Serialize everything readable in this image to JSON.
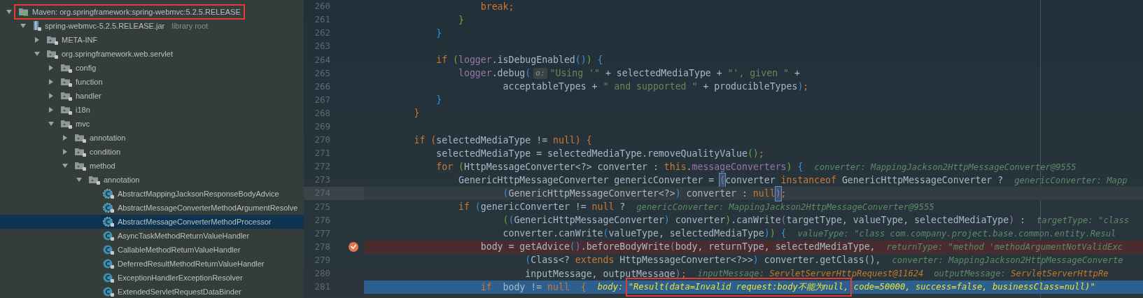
{
  "project_tree": {
    "items": [
      {
        "kind": "library",
        "label": "Maven: org.springframework:spring-webmvc:5.2.5.RELEASE",
        "expanded": true,
        "selected": false,
        "outlined": true,
        "children": [
          {
            "kind": "jar",
            "label": "spring-webmvc-5.2.5.RELEASE.jar",
            "note": "library root",
            "expanded": true,
            "selected": false,
            "outlined": false,
            "children": [
              {
                "kind": "package",
                "label": "META-INF",
                "expanded": false,
                "selected": false,
                "outlined": false
              },
              {
                "kind": "package",
                "label": "org.springframework.web.servlet",
                "expanded": true,
                "selected": false,
                "outlined": false,
                "children": [
                  {
                    "kind": "package",
                    "label": "config",
                    "expanded": false,
                    "selected": false,
                    "outlined": false
                  },
                  {
                    "kind": "package",
                    "label": "function",
                    "expanded": false,
                    "selected": false,
                    "outlined": false
                  },
                  {
                    "kind": "package",
                    "label": "handler",
                    "expanded": false,
                    "selected": false,
                    "outlined": false
                  },
                  {
                    "kind": "package",
                    "label": "i18n",
                    "expanded": false,
                    "selected": false,
                    "outlined": false
                  },
                  {
                    "kind": "package",
                    "label": "mvc",
                    "expanded": true,
                    "selected": false,
                    "outlined": false,
                    "children": [
                      {
                        "kind": "package",
                        "label": "annotation",
                        "expanded": false,
                        "selected": false,
                        "outlined": false
                      },
                      {
                        "kind": "package",
                        "label": "condition",
                        "expanded": false,
                        "selected": false,
                        "outlined": false
                      },
                      {
                        "kind": "package",
                        "label": "method",
                        "expanded": true,
                        "selected": false,
                        "outlined": false,
                        "children": [
                          {
                            "kind": "package",
                            "label": "annotation",
                            "expanded": true,
                            "selected": false,
                            "outlined": false,
                            "children": [
                              {
                                "kind": "abstract_class",
                                "label": "AbstractMappingJacksonResponseBodyAdvice",
                                "selected": false,
                                "outlined": false
                              },
                              {
                                "kind": "abstract_class",
                                "label": "AbstractMessageConverterMethodArgumentResolve",
                                "selected": false,
                                "outlined": false
                              },
                              {
                                "kind": "abstract_class",
                                "label": "AbstractMessageConverterMethodProcessor",
                                "selected": true,
                                "outlined": false
                              },
                              {
                                "kind": "class",
                                "label": "AsyncTaskMethodReturnValueHandler",
                                "selected": false,
                                "outlined": false
                              },
                              {
                                "kind": "class",
                                "label": "CallableMethodReturnValueHandler",
                                "selected": false,
                                "outlined": false
                              },
                              {
                                "kind": "class",
                                "label": "DeferredResultMethodReturnValueHandler",
                                "selected": false,
                                "outlined": false
                              },
                              {
                                "kind": "class",
                                "label": "ExceptionHandlerExceptionResolver",
                                "selected": false,
                                "outlined": false
                              },
                              {
                                "kind": "class",
                                "label": "ExtendedServletRequestDataBinder",
                                "selected": false,
                                "outlined": false
                              }
                            ]
                          }
                        ]
                      }
                    ]
                  }
                ]
              }
            ]
          }
        ]
      }
    ]
  },
  "editor": {
    "lines": [
      {
        "number": "260",
        "tokens": [
          {
            "kind": "keyword",
            "text": "                    break;"
          }
        ]
      },
      {
        "number": "261",
        "tokens": [
          {
            "kind": "brace_green",
            "text": "                }"
          }
        ]
      },
      {
        "number": "262",
        "tokens": [
          {
            "kind": "brace_blue",
            "text": "            }"
          }
        ]
      },
      {
        "number": "263"
      },
      {
        "number": "264",
        "tokens": [
          {
            "kind": "keyword",
            "text": "            if "
          },
          {
            "kind": "brace_green",
            "text": "("
          },
          {
            "kind": "field",
            "text": "logger"
          },
          {
            "kind": "plain",
            "text": ".isDebugEnabled"
          },
          {
            "kind": "brace_blue",
            "text": "()"
          },
          {
            "kind": "brace_green",
            "text": ")"
          },
          {
            "kind": "brace_blue",
            "text": " {"
          }
        ]
      },
      {
        "number": "265",
        "tokens": [
          {
            "kind": "field",
            "text": "                logger"
          },
          {
            "kind": "plain",
            "text": ".debug"
          },
          {
            "kind": "brace_blue",
            "text": "("
          },
          {
            "kind": "param_hint",
            "text": "o:"
          },
          {
            "kind": "string",
            "text": "\"Using '\""
          },
          {
            "kind": "plain",
            "text": " + selectedMediaType + "
          },
          {
            "kind": "string",
            "text": "\"', given \""
          },
          {
            "kind": "plain",
            "text": " +"
          }
        ]
      },
      {
        "number": "266",
        "tokens": [
          {
            "kind": "plain",
            "text": "                        acceptableTypes + "
          },
          {
            "kind": "string",
            "text": "\" and supported \""
          },
          {
            "kind": "plain",
            "text": " + producibleTypes"
          },
          {
            "kind": "brace_blue",
            "text": ")"
          },
          {
            "kind": "keyword",
            "text": ";"
          }
        ]
      },
      {
        "number": "267",
        "tokens": [
          {
            "kind": "brace_blue",
            "text": "            }"
          }
        ]
      },
      {
        "number": "268",
        "tokens": [
          {
            "kind": "keyword",
            "text": "        }"
          }
        ]
      },
      {
        "number": "269"
      },
      {
        "number": "270",
        "tokens": [
          {
            "kind": "keyword",
            "text": "        if ("
          },
          {
            "kind": "plain",
            "text": "selectedMediaType != "
          },
          {
            "kind": "keyword",
            "text": "null) {"
          }
        ]
      },
      {
        "number": "271",
        "tokens": [
          {
            "kind": "plain",
            "text": "            selectedMediaType = selectedMediaType.removeQualityValue"
          },
          {
            "kind": "brace_green",
            "text": "()"
          },
          {
            "kind": "keyword",
            "text": ";"
          }
        ]
      },
      {
        "number": "272",
        "tokens": [
          {
            "kind": "keyword",
            "text": "            for "
          },
          {
            "kind": "brace_green",
            "text": "("
          },
          {
            "kind": "plain",
            "text": "HttpMessageConverter<?> converter : "
          },
          {
            "kind": "keyword",
            "text": "this"
          },
          {
            "kind": "plain",
            "text": "."
          },
          {
            "kind": "field",
            "text": "messageConverters"
          },
          {
            "kind": "brace_green",
            "text": ")"
          },
          {
            "kind": "brace_blue",
            "text": " {"
          },
          {
            "kind": "hint",
            "text": "converter: MappingJackson2HttpMessageConverter@9555"
          }
        ]
      },
      {
        "number": "273",
        "tokens": [
          {
            "kind": "plain",
            "text": "                GenericHttpMessageConverter genericConverter = "
          },
          {
            "kind": "matched_brace",
            "text": "("
          },
          {
            "kind": "plain",
            "text": "converter "
          },
          {
            "kind": "keyword",
            "text": "instanceof"
          },
          {
            "kind": "plain",
            "text": " GenericHttpMessageConverter ?"
          },
          {
            "kind": "hint",
            "text": "genericConverter: Mapp"
          }
        ]
      },
      {
        "number": "274",
        "kind": "caret",
        "tokens": [
          {
            "kind": "brace_blue",
            "text": "                        ("
          },
          {
            "kind": "plain",
            "text": "GenericHttpMessageConverter<?>"
          },
          {
            "kind": "brace_blue",
            "text": ")"
          },
          {
            "kind": "plain",
            "text": " converter : "
          },
          {
            "kind": "keyword",
            "text": "null"
          },
          {
            "kind": "matched_brace",
            "text": ")"
          },
          {
            "kind": "keyword",
            "text": ";"
          }
        ]
      },
      {
        "number": "275",
        "tokens": [
          {
            "kind": "keyword",
            "text": "                if "
          },
          {
            "kind": "brace_blue",
            "text": "("
          },
          {
            "kind": "plain",
            "text": "genericConverter != "
          },
          {
            "kind": "keyword",
            "text": "null"
          },
          {
            "kind": "plain",
            "text": " ?"
          },
          {
            "kind": "hint",
            "text": "genericConverter: MappingJackson2HttpMessageConverter@9555"
          }
        ]
      },
      {
        "number": "276",
        "tokens": [
          {
            "kind": "brace_green",
            "text": "                        ("
          },
          {
            "kind": "brace_blue",
            "text": "("
          },
          {
            "kind": "plain",
            "text": "GenericHttpMessageConverter"
          },
          {
            "kind": "brace_blue",
            "text": ")"
          },
          {
            "kind": "plain",
            "text": " converter"
          },
          {
            "kind": "brace_green",
            "text": ")"
          },
          {
            "kind": "plain",
            "text": ".canWrite"
          },
          {
            "kind": "field",
            "text": "("
          },
          {
            "kind": "plain",
            "text": "targetType, valueType, selectedMediaType"
          },
          {
            "kind": "field",
            "text": ")"
          },
          {
            "kind": "plain",
            "text": " :"
          },
          {
            "kind": "hint",
            "text": "targetType: \"class"
          }
        ]
      },
      {
        "number": "277",
        "tokens": [
          {
            "kind": "plain",
            "text": "                        converter.canWrite"
          },
          {
            "kind": "brace_blue",
            "text": "("
          },
          {
            "kind": "plain",
            "text": "valueType, selectedMediaType"
          },
          {
            "kind": "brace_blue",
            "text": ")"
          },
          {
            "kind": "brace_green",
            "text": ")"
          },
          {
            "kind": "brace_blue",
            "text": " {"
          },
          {
            "kind": "hint",
            "text": "valueType: \"class com.company.project.base.common.entity.Resul"
          }
        ]
      },
      {
        "number": "278",
        "kind": "breakpoint",
        "tokens": [
          {
            "kind": "plain",
            "text": "                    body = getAdvice"
          },
          {
            "kind": "brace_blue",
            "text": "()"
          },
          {
            "kind": "plain",
            "text": ".beforeBodyWrite"
          },
          {
            "kind": "field",
            "text": "("
          },
          {
            "kind": "plain",
            "text": "body, returnType, selectedMediaType,"
          },
          {
            "kind": "hint",
            "text": "returnType: \"method 'methodArgumentNotValidExc"
          }
        ]
      },
      {
        "number": "279",
        "tokens": [
          {
            "kind": "brace_blue",
            "text": "                            ("
          },
          {
            "kind": "plain",
            "text": "Class<? "
          },
          {
            "kind": "keyword",
            "text": "extends"
          },
          {
            "kind": "plain",
            "text": " HttpMessageConverter<?>>"
          },
          {
            "kind": "brace_blue",
            "text": ")"
          },
          {
            "kind": "plain",
            "text": " converter.getClass(),"
          },
          {
            "kind": "hint",
            "text": "converter: MappingJackson2HttpMessageConverte"
          }
        ]
      },
      {
        "number": "280",
        "tokens": [
          {
            "kind": "plain",
            "text": "                            inputMessage, outputMessage"
          },
          {
            "kind": "field",
            "text": ")"
          },
          {
            "kind": "keyword",
            "text": ";"
          },
          {
            "kind": "hint",
            "text": "inputMessage: "
          },
          {
            "kind": "hint_object",
            "text": "ServletServerHttpRequest@11624"
          },
          {
            "kind": "hint",
            "text": "  outputMessage: "
          },
          {
            "kind": "hint_object",
            "text": "ServletServerHttpRe"
          }
        ]
      },
      {
        "number": "281",
        "kind": "execution",
        "tokens": [
          {
            "kind": "keyword",
            "text": "                    if"
          },
          {
            "kind": "plain",
            "text": "  body != "
          },
          {
            "kind": "keyword",
            "text": "null  {"
          },
          {
            "kind": "hint_current",
            "text": "body: "
          },
          {
            "kind": "hint_current_boxed",
            "text": "\"Result(data=Invalid request:body不能为null,"
          },
          {
            "kind": "hint_current",
            "text": " code=50000, success=false, businessClass=null)\""
          }
        ]
      }
    ]
  }
}
